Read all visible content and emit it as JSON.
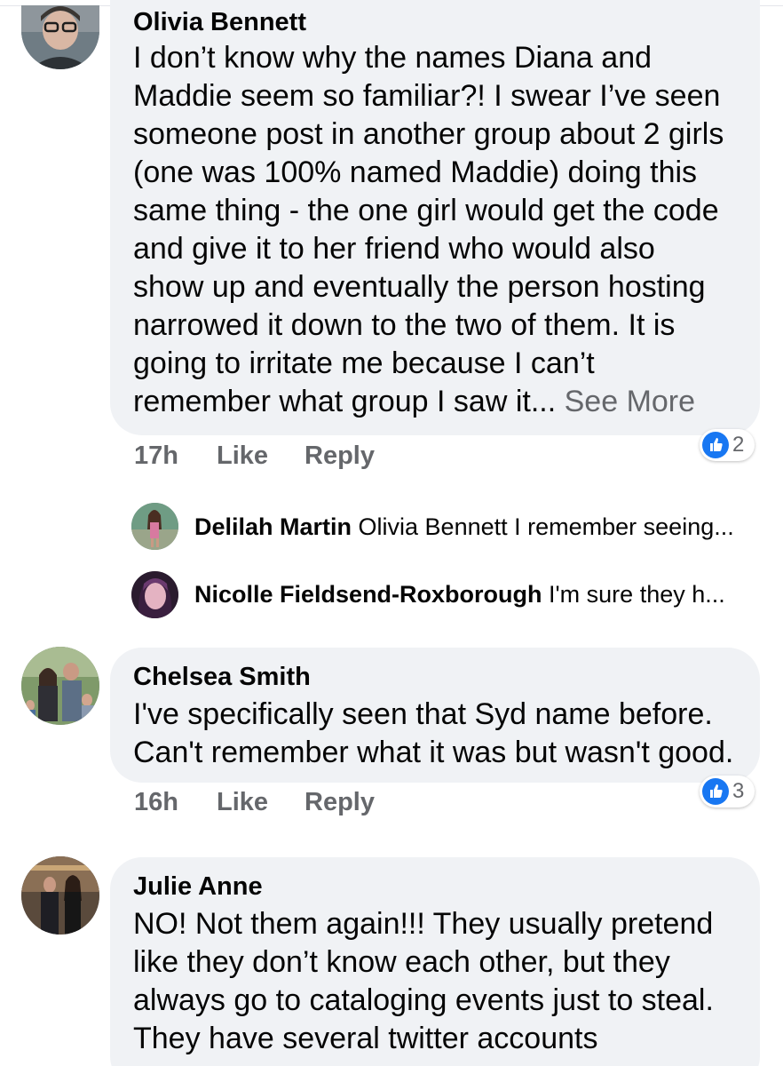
{
  "comments": [
    {
      "author": "Olivia Bennett",
      "lines": [
        "I don’t know why the names Diana and",
        "Maddie seem so familiar?! I swear I’ve seen",
        "someone post in another group about 2 girls",
        "(one was 100% named Maddie) doing this",
        "same thing - the one girl would get the code",
        "and give it to her friend who would also",
        "show up and eventually the person hosting",
        "narrowed it down to the two of them. It is",
        "going to irritate me because I can’t",
        "remember what group I saw it..."
      ],
      "see_more": " See More",
      "time": "17h",
      "like_label": "Like",
      "reply_label": "Reply",
      "reaction_count": "2",
      "reaction_icon": "thumbs-up-icon"
    },
    {
      "author": "Chelsea Smith",
      "lines": [
        "I've specifically seen that Syd name before.",
        "Can't remember what it was but wasn't good."
      ],
      "time": "16h",
      "like_label": "Like",
      "reply_label": "Reply",
      "reaction_count": "3",
      "reaction_icon": "thumbs-up-icon"
    },
    {
      "author": "Julie Anne",
      "lines": [
        "NO! Not them again!!! They usually pretend",
        "like they don’t know each other, but they",
        "always go to cataloging events just to steal.",
        "They have several twitter accounts"
      ]
    }
  ],
  "replies": [
    {
      "author": "Delilah Martin",
      "text": " Olivia Bennett I remember seeing..."
    },
    {
      "author": "Nicolle Fieldsend-Roxborough",
      "text": " I'm sure they h..."
    }
  ],
  "colors": {
    "bubble": "#f0f2f5",
    "secondary_text": "#65676b",
    "like_blue": "#1877f2"
  }
}
